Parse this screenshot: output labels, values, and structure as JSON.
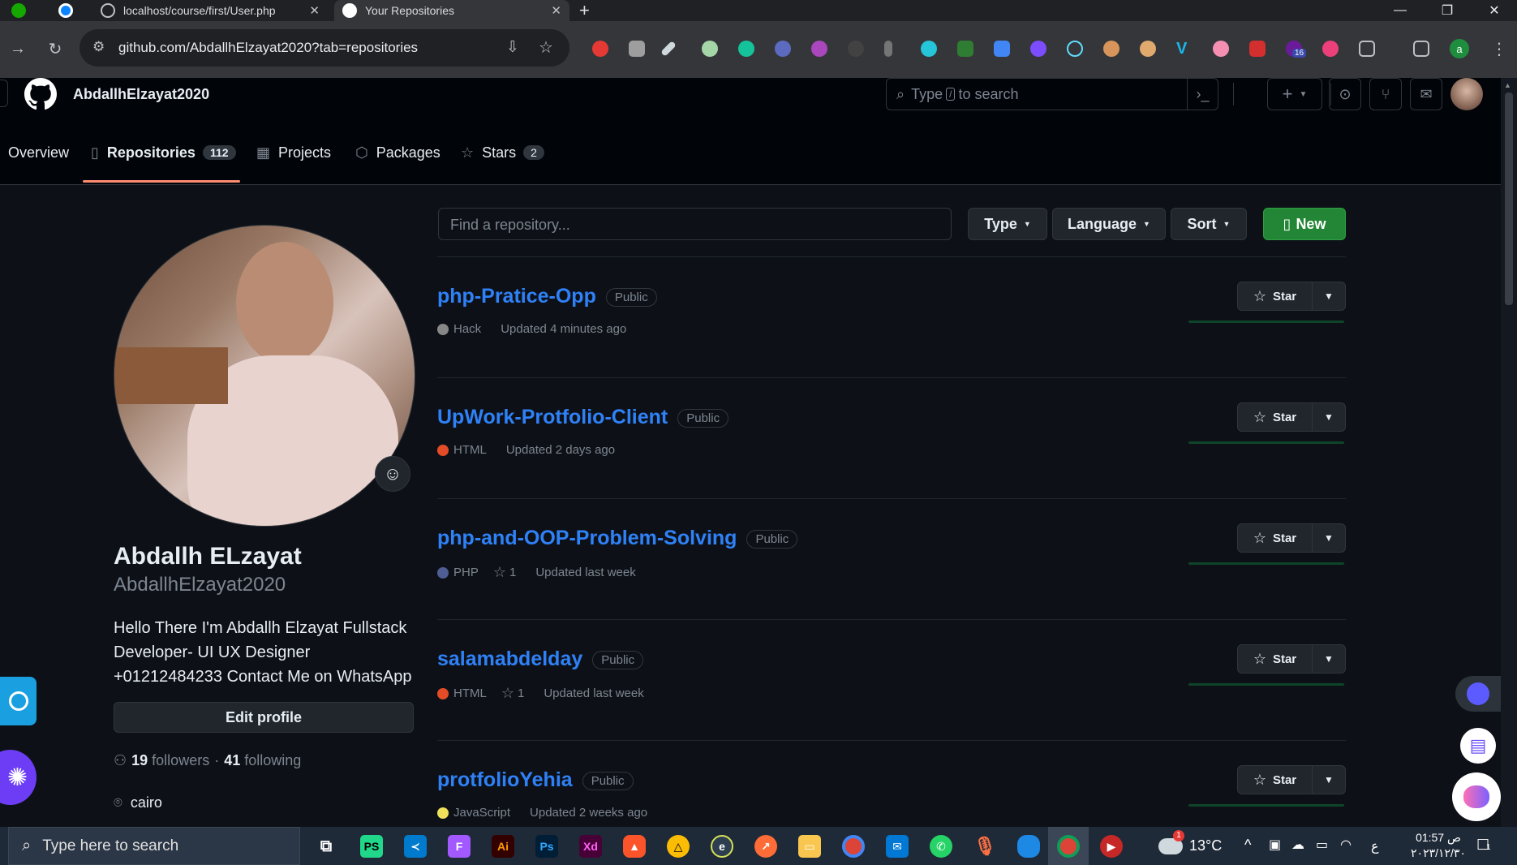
{
  "browser": {
    "tabs": [
      {
        "label": ""
      },
      {
        "label": ""
      },
      {
        "label": "localhost/course/first/User.php"
      },
      {
        "label": "Your Repositories"
      }
    ],
    "new_tab": "+",
    "url": "github.com/AbdallhElzayat2020?tab=repositories",
    "profile_initial": "a",
    "ext_badge": "16"
  },
  "header": {
    "username": "AbdallhElzayat2020",
    "search_placeholder_pre": "Type",
    "search_key": "/",
    "search_placeholder_post": "to search",
    "plus": "+"
  },
  "nav": {
    "tabs": [
      {
        "label": "Overview",
        "icon": "book-open-icon"
      },
      {
        "label": "Repositories",
        "icon": "repo-icon",
        "count": "112",
        "active": true
      },
      {
        "label": "Projects",
        "icon": "table-icon"
      },
      {
        "label": "Packages",
        "icon": "package-icon"
      },
      {
        "label": "Stars",
        "icon": "star-icon",
        "count": "2"
      }
    ]
  },
  "profile": {
    "name": "Abdallh ELzayat",
    "login": "AbdallhElzayat2020",
    "bio": [
      "Hello There I'm Abdallh Elzayat Fullstack",
      "Developer- UI UX Designer",
      "+01212484233 Contact Me on WhatsApp"
    ],
    "edit_label": "Edit profile",
    "followers": "19",
    "followers_label": "followers",
    "separator": "·",
    "following": "41",
    "following_label": "following",
    "location": "cairo"
  },
  "filters": {
    "search_placeholder": "Find a repository...",
    "type": "Type",
    "language": "Language",
    "sort": "Sort",
    "new": "New"
  },
  "repos": [
    {
      "name": "php-Pratice-Opp",
      "visibility": "Public",
      "lang": "Hack",
      "lang_color": "#878787",
      "stars": "",
      "updated": "Updated 4 minutes ago"
    },
    {
      "name": "UpWork-Protfolio-Client",
      "visibility": "Public",
      "lang": "HTML",
      "lang_color": "#e34c26",
      "stars": "",
      "updated": "Updated 2 days ago"
    },
    {
      "name": "php-and-OOP-Problem-Solving",
      "visibility": "Public",
      "lang": "PHP",
      "lang_color": "#4F5D95",
      "stars": "1",
      "updated": "Updated last week"
    },
    {
      "name": "salamabdelday",
      "visibility": "Public",
      "lang": "HTML",
      "lang_color": "#e34c26",
      "stars": "1",
      "updated": "Updated last week"
    },
    {
      "name": "protfolioYehia",
      "visibility": "Public",
      "lang": "JavaScript",
      "lang_color": "#f1e05a",
      "stars": "",
      "updated": "Updated 2 weeks ago"
    }
  ],
  "star_label": "Star",
  "taskbar": {
    "search_placeholder": "Type here to search",
    "apps": [
      "PS",
      "Ai",
      "Ps",
      "Xd"
    ],
    "weather": "13°C",
    "weather_badge": "1",
    "time": "01:57 ص",
    "date": "٢٠٢٣/١٢/٣٠",
    "lang": "ع",
    "notif_count": "1"
  }
}
